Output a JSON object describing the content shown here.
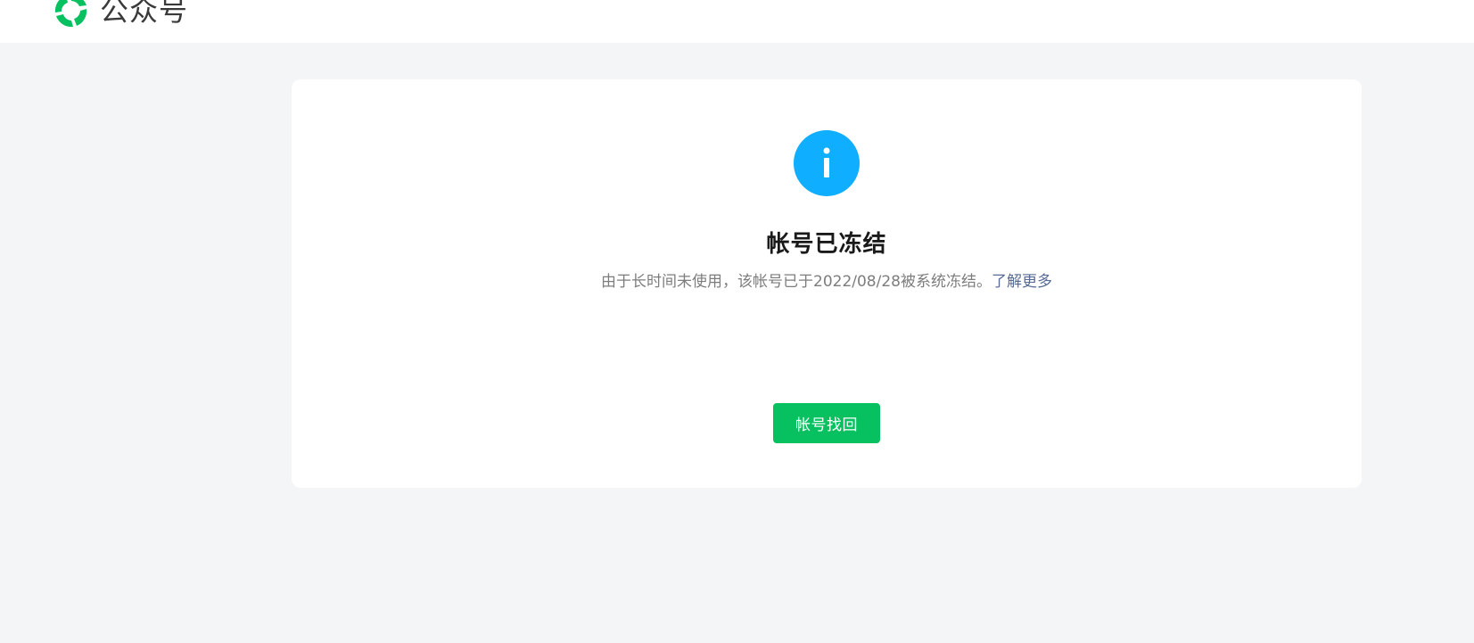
{
  "header": {
    "brand_name": "公众号",
    "logo_icon": "wechat-official-account-logo-icon",
    "brand_color": "#07c160"
  },
  "notice": {
    "icon": "info-icon",
    "icon_color": "#10aeff",
    "title": "帐号已冻结",
    "description": "由于长时间未使用，该帐号已于2022/08/28被系统冻结。",
    "learn_more_label": "了解更多",
    "link_color": "#576b95"
  },
  "actions": {
    "recover_label": "帐号找回",
    "button_color": "#07c160"
  }
}
